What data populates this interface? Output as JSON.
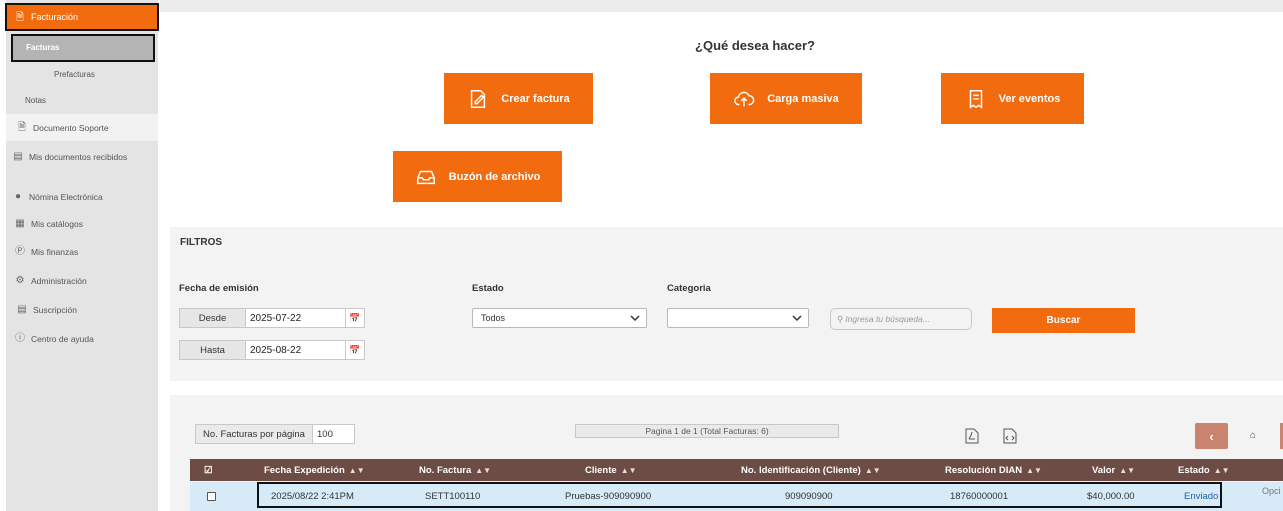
{
  "sidebar": {
    "facturacion": "Facturación",
    "facturas": "Facturas",
    "prefacturas": "Prefacturas",
    "notas": "Notas",
    "documento_soporte": "Documento Soporte",
    "mis_documentos": "Mis documentos recibidos",
    "nomina": "Nómina Electrónica",
    "catalogos": "Mis catálogos",
    "finanzas": "Mis finanzas",
    "administracion": "Administración",
    "suscripcion": "Suscripción",
    "ayuda": "Centro de ayuda"
  },
  "actions": {
    "question": "¿Qué desea hacer?",
    "crear": "Crear factura",
    "carga": "Carga masiva",
    "eventos": "Ver eventos",
    "buzon": "Buzón de archivo"
  },
  "filters": {
    "title": "FILTROS",
    "fecha_label": "Fecha de emisión",
    "estado_label": "Estado",
    "categoria_label": "Categoria",
    "desde_label": "Desde",
    "desde_value": "2025-07-22",
    "hasta_label": "Hasta",
    "hasta_value": "2025-08-22",
    "estado_value": "Todos",
    "categoria_value": "",
    "search_placeholder": "Ingresa tu búsqueda...",
    "buscar": "Buscar"
  },
  "results": {
    "per_page_label": "No. Facturas por página",
    "per_page_value": "100",
    "page_info": "Pagina 1 de 1 (Total Facturas: 6)",
    "columns": [
      "Fecha Expedición",
      "No. Factura",
      "Cliente",
      "No. Identificación (Cliente)",
      "Resolución DIAN",
      "Valor",
      "Estado"
    ],
    "rows": [
      {
        "fecha": "2025/08/22 2:41PM",
        "factura": "SETT100110",
        "cliente": "Pruebas-909090900",
        "identificacion": "909090900",
        "resolucion": "18760000001",
        "valor": "$40,000.00",
        "estado": "Enviado",
        "opciones": "Opci"
      }
    ]
  },
  "colors": {
    "accent": "#f26b0f",
    "table_header": "#6d4c46",
    "row_highlight": "#d6ebf7",
    "link": "#1f5fa8"
  }
}
